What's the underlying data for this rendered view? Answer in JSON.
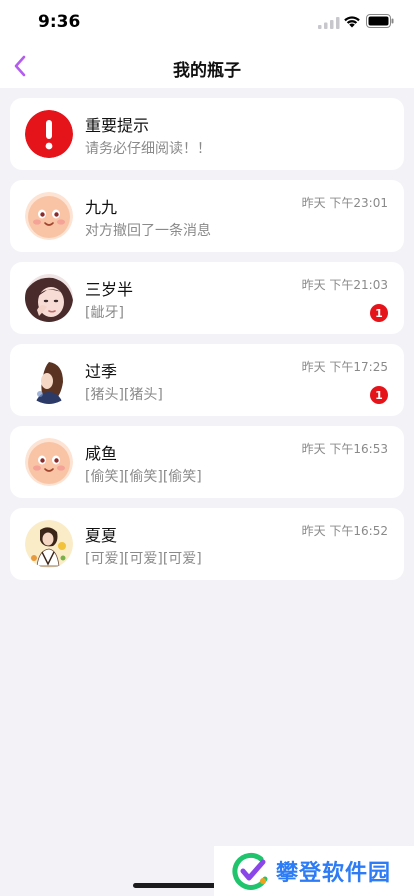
{
  "status_bar": {
    "time": "9:36"
  },
  "nav": {
    "title": "我的瓶子",
    "back_icon": "chevron-left-icon",
    "accent_color": "#b35cf0"
  },
  "notice": {
    "title": "重要提示",
    "subtitle": "请务必仔细阅读！！",
    "icon": "alert-icon",
    "icon_color": "#e5131a"
  },
  "conversations": [
    {
      "name": "九九",
      "preview": "对方撤回了一条消息",
      "time": "昨天 下午23:01",
      "badge": null
    },
    {
      "name": "三岁半",
      "preview": "[龇牙]",
      "time": "昨天 下午21:03",
      "badge": "1"
    },
    {
      "name": "过季",
      "preview": "[猪头][猪头]",
      "time": "昨天 下午17:25",
      "badge": "1"
    },
    {
      "name": "咸鱼",
      "preview": "[偷笑][偷笑][偷笑]",
      "time": "昨天 下午16:53",
      "badge": null
    },
    {
      "name": "夏夏",
      "preview": "[可爱][可爱][可爱]",
      "time": "昨天 下午16:52",
      "badge": null
    }
  ],
  "watermark": {
    "text": "攀登软件园"
  },
  "colors": {
    "background": "#f2f2f7",
    "badge": "#e5131a",
    "muted_text": "#8a8a8a"
  }
}
